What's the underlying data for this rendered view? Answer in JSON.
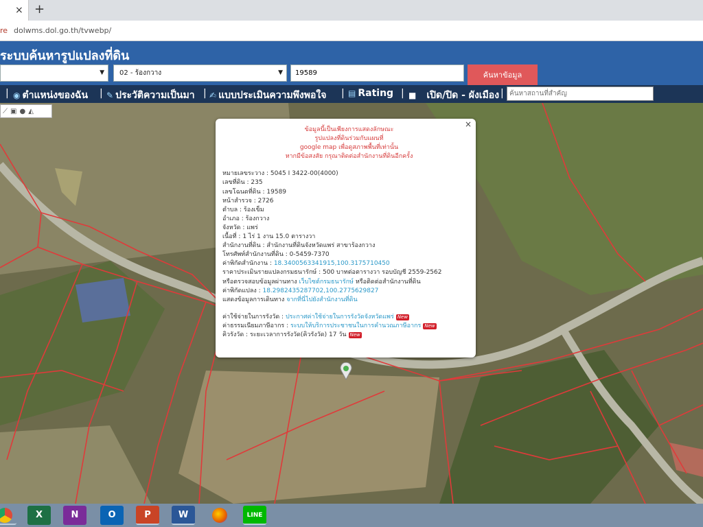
{
  "browser": {
    "tab_close": "×",
    "new_tab": "+",
    "url_prefix": "re",
    "url": "dolwms.dol.go.th/tvwebp/"
  },
  "header": {
    "title": "ระบบค้นหารูปแปลงที่ดิน"
  },
  "search": {
    "province_value": "",
    "amphoe_value": "02 - ร้องกวาง",
    "deed_number": "19589",
    "button_label": "ค้นหาข้อมูล"
  },
  "menu": {
    "items": [
      {
        "label": "ตำแหน่งของฉัน",
        "icon": "location-icon"
      },
      {
        "label": "ประวัติความเป็นมา",
        "icon": "history-icon"
      },
      {
        "label": "แบบประเมินความพึงพอใจ",
        "icon": "survey-icon"
      },
      {
        "label": "Rating",
        "icon": "rating-icon"
      },
      {
        "label": "เปิด/ปิด - ผังเมือง",
        "icon": "checkbox-icon"
      }
    ],
    "place_search_placeholder": "ค้นหาสถานที่สำคัญ"
  },
  "popup": {
    "close": "×",
    "warning": [
      "ข้อมูลนี้เป็นเพียงการแสดงลักษณะ",
      "รูปแปลงที่ดินร่วมกับแผนที่",
      "google map เพื่อดูสภาพพื้นที่เท่านั้น",
      "หากมีข้อสงสัย กรุณาติดต่อสำนักงานที่ดินอีกครั้ง"
    ],
    "fields": {
      "survey_no": "หมายเลขระวาง : 5045 I 3422-00(4000)",
      "land_no": "เลขที่ดิน : 235",
      "deed_no": "เลขโฉนดที่ดิน : 19589",
      "page_no": "หน้าสำรวจ : 2726",
      "tambon": "ตำบล : ร้องเข็ม",
      "amphoe": "อำเภอ : ร้องกวาง",
      "province": "จังหวัด : แพร่",
      "area": "เนื้อที่ : 1 ไร่ 1 งาน 15.0 ตารางวา",
      "office": "สำนักงานที่ดิน : สำนักงานที่ดินจังหวัดแพร่ สาขาร้องกวาง",
      "phone": "โทรศัพท์สำนักงานที่ดิน : 0-5459-7370",
      "office_coord_label": "ค่าพิกัดสำนักงาน : ",
      "office_coord": "18.3400563341915,100.3175710450",
      "price": "ราคาประเมินรายแปลงกรมธนารักษ์ : 500 บาทต่อตารางวา รอบบัญชี 2559-2562",
      "check_label": "หรือตรวจสอบข้อมูลผ่านทาง ",
      "check_link": "เว็บไซต์กรมธนารักษ์",
      "check_tail": " หรือติดต่อสำนักงานที่ดิน",
      "parcel_coord_label": "ค่าพิกัดแปลง : ",
      "parcel_coord": "18.2982435287702,100.2775629827",
      "route_label": "แสดงข้อมูลการเดินทาง ",
      "route_link": "จากที่นี่ไปยังสำนักงานที่ดิน",
      "fee_label": "ค่าใช้จ่ายในการรังวัด : ",
      "fee_link": "ประกาศค่าใช้จ่ายในการรังวัดจังหวัดแพร่",
      "tax_label": "ค่าธรรมเนียมภาษีอากร : ",
      "tax_link": "ระบบให้บริการประชาชนในการคำนวณภาษีอากร",
      "queue_label": "คิวรังวัด : ระยะเวลาการรังวัด(คิวรังวัด) 17 วัน",
      "new_badge": "New"
    }
  },
  "taskbar": {
    "apps": [
      {
        "name": "chrome",
        "label": "",
        "color": "#dd4b39"
      },
      {
        "name": "excel",
        "label": "X",
        "color": "#1d7044"
      },
      {
        "name": "onenote",
        "label": "N",
        "color": "#7a2c99"
      },
      {
        "name": "outlook",
        "label": "O",
        "color": "#0a64b4"
      },
      {
        "name": "powerpoint",
        "label": "P",
        "color": "#c94426"
      },
      {
        "name": "word",
        "label": "W",
        "color": "#2b5797"
      },
      {
        "name": "firefox",
        "label": "",
        "color": "#e66000"
      },
      {
        "name": "line",
        "label": "LINE",
        "color": "#00b900"
      }
    ]
  },
  "colors": {
    "header": "#2e63a7",
    "menubar": "#1c3557",
    "search_button": "#e0585a",
    "parcel_line": "#e03a3a"
  }
}
